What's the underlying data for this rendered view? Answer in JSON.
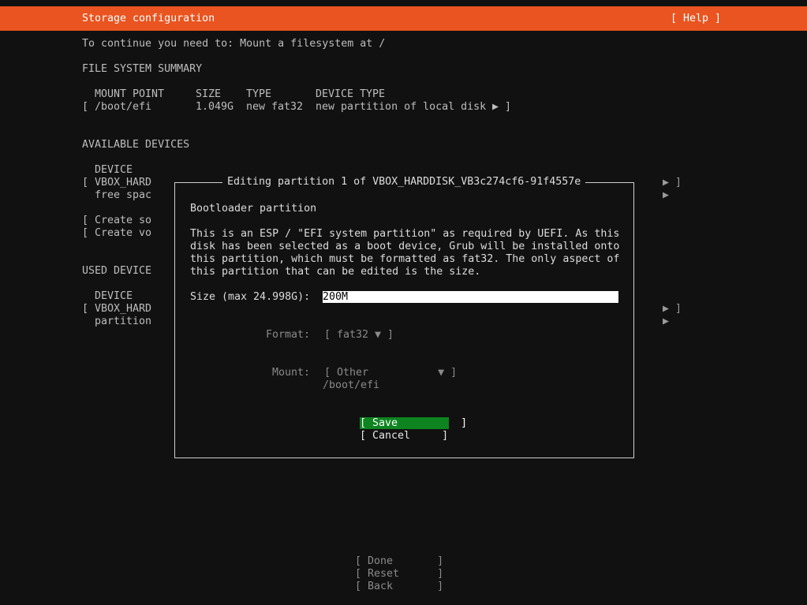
{
  "header": {
    "title": "Storage configuration",
    "help": "[ Help ]"
  },
  "instruction": "To continue you need to: Mount a filesystem at /",
  "fs_summary": {
    "heading": "FILE SYSTEM SUMMARY",
    "columns": [
      "MOUNT POINT",
      "SIZE",
      "TYPE",
      "DEVICE TYPE"
    ],
    "rows": [
      {
        "open": "[",
        "mount": "/boot/efi",
        "size": "1.049G",
        "type": "new fat32",
        "device_type": "new partition of local disk",
        "arrow": "▶",
        "close": "]"
      }
    ]
  },
  "available_devices": {
    "heading": "AVAILABLE DEVICES",
    "column_device": "DEVICE",
    "device_open": "[",
    "device_name": "VBOX_HARD",
    "free_space": "free spac",
    "create_sw": "[ Create so",
    "create_vg": "[ Create vo",
    "arrow_close": "▶ ]",
    "arrow": "▶"
  },
  "used_devices": {
    "heading": "USED DEVICE",
    "column_device": "DEVICE",
    "device_open": "[",
    "device_name": "VBOX_HARD",
    "partition": "partition",
    "arrow_close": "▶ ]",
    "arrow": "▶"
  },
  "dialog": {
    "title": "Editing partition 1 of VBOX_HARDDISK_VB3c274cf6-91f4557e",
    "subtitle": "Bootloader partition",
    "description_lines": [
      "This is an ESP / \"EFI system partition\" as required by UEFI. As this",
      "disk has been selected as a boot device, Grub will be installed onto",
      "this partition, which must be formatted as fat32. The only aspect of",
      "this partition that can be edited is the size."
    ],
    "size_label": "Size (max 24.998G):",
    "size_value": "200M",
    "format_label": "Format:",
    "format_value": "[ fat32 ▼ ]",
    "mount_label": "Mount:",
    "mount_value": "[ Other           ▼ ]",
    "mount_path": "/boot/efi",
    "save_label": "[ Save          ]",
    "cancel_label": "[ Cancel     ]"
  },
  "bottom_buttons": {
    "done": "[ Done       ]",
    "reset": "[ Reset      ]",
    "back": "[ Back       ]"
  },
  "colors": {
    "header_bg": "#e95420",
    "save_bg": "#0e8420",
    "background": "#111111"
  }
}
